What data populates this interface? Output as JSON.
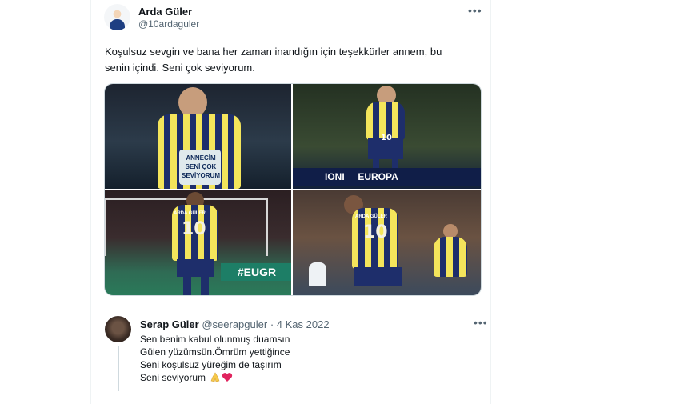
{
  "tweet": {
    "author_name": "Arda Güler",
    "author_handle": "@10ardaguler",
    "more_icon": "more-horizontal-icon",
    "text_line1": "Koşulsuz sevgin ve bana her zaman inandığın için teşekkürler annem, bu",
    "text_line2": "senin içindi. Seni çok seviyorum.",
    "photos": {
      "photo1": {
        "shirt_text_line1": "ANNECİM",
        "shirt_text_line2": "SENİ ÇOK",
        "shirt_text_line3": "SEVİYORUM"
      },
      "photo2": {
        "shirt_number": "10",
        "banner_text": "IONI     EUROPA"
      },
      "photo3": {
        "shirt_name": "ARDA GÜLER",
        "shirt_number": "10",
        "banner_text": "#EUGR"
      },
      "photo4": {
        "shirt_name": "ARDA GÜLER",
        "shirt_number": "10"
      }
    }
  },
  "reply": {
    "author_name": "Serap Güler",
    "author_handle": "@seerapguler",
    "separator": "·",
    "date": "4 Kas 2022",
    "more_icon": "more-horizontal-icon",
    "lines": [
      "Sen benim kabul olunmuş duamsın",
      "Gülen yüzümsün.Ömrüm yettiğince",
      "Seni koşulsuz yüreğim de taşırım",
      "Seni seviyorum"
    ],
    "emojis": [
      "folded-hands-emoji",
      "red-heart-emoji"
    ]
  },
  "colors": {
    "text_primary": "#0f1419",
    "text_secondary": "#536471",
    "border": "#eff3f4",
    "fenerbahce_yellow": "#f4e55b",
    "fenerbahce_navy": "#1e2e6b",
    "heart_red": "#e0245e"
  }
}
